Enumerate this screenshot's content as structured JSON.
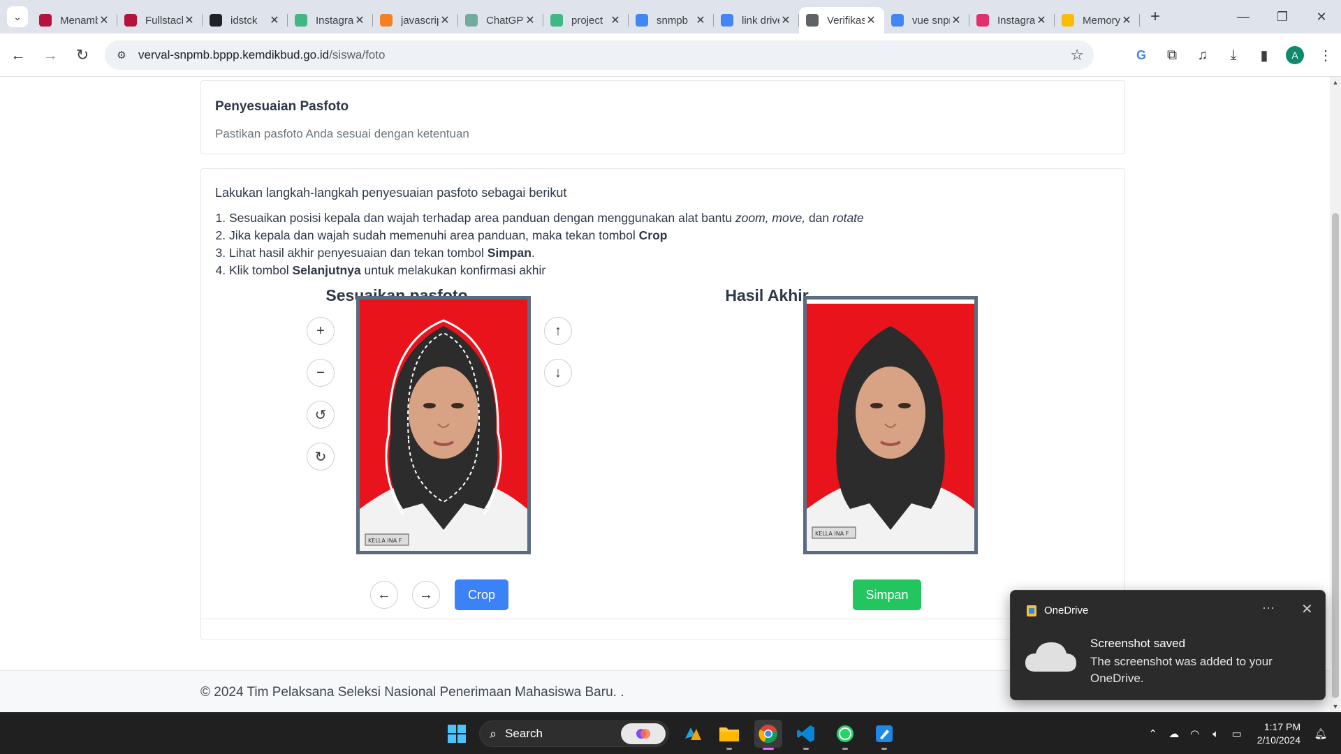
{
  "browser": {
    "tabs": [
      {
        "title": "Menambahkan",
        "favicon_color": "#b5123e",
        "active": false
      },
      {
        "title": "Fullstack",
        "favicon_color": "#b5123e",
        "active": false
      },
      {
        "title": "idstck",
        "favicon_color": "#1f2328",
        "active": false
      },
      {
        "title": "Instagram",
        "favicon_color": "#41b883",
        "active": false
      },
      {
        "title": "javascript",
        "favicon_color": "#f48024",
        "active": false
      },
      {
        "title": "ChatGPT",
        "favicon_color": "#74aa9c",
        "active": false
      },
      {
        "title": "project",
        "favicon_color": "#41b883",
        "active": false
      },
      {
        "title": "snmpb",
        "favicon_color": "#4285f4",
        "active": false
      },
      {
        "title": "link drive",
        "favicon_color": "#4285f4",
        "active": false
      },
      {
        "title": "Verifikasi",
        "favicon_color": "#5f6368",
        "active": true
      },
      {
        "title": "vue snpmb",
        "favicon_color": "#4285f4",
        "active": false
      },
      {
        "title": "Instagram",
        "favicon_color": "#e1306c",
        "active": false
      },
      {
        "title": "Memory",
        "favicon_color": "#fbbc05",
        "active": false
      }
    ],
    "url_host": "verval-snpmb.bppp.kemdikbud.go.id",
    "url_path": "/siswa/foto",
    "profile_initial": "A"
  },
  "header_card": {
    "title": "Penyesuaian Pasfoto",
    "subtitle": "Pastikan pasfoto Anda sesuai dengan ketentuan"
  },
  "instructions": {
    "intro": "Lakukan langkah-langkah penyesuaian pasfoto sebagai berikut",
    "step1_text": "Sesuaikan posisi kepala dan wajah terhadap area panduan dengan menggunakan alat bantu ",
    "step1_zoom": "zoom",
    "step1_move": "move",
    "step1_and": "dan",
    "step1_rotate": "rotate",
    "step2_text": "Jika kepala dan wajah sudah memenuhi area panduan, maka tekan tombol ",
    "step2_bold": "Crop",
    "step3_text": "Lihat hasil akhir penyesuaian dan tekan tombol ",
    "step3_bold": "Simpan",
    "step4_text": "Klik tombol ",
    "step4_bold": "Selanjutnya",
    "step4_rest": " untuk melakukan konfirmasi akhir"
  },
  "editor": {
    "title": "Sesuaikan pasfoto Anda",
    "crop_label": "Crop",
    "photo_id_label": "KELLA INA F",
    "background_color": "#e8131b"
  },
  "result": {
    "title": "Hasil Akhir",
    "save_label": "Simpan"
  },
  "footer": {
    "text": "© 2024 Tim Pelaksana Seleksi Nasional Penerimaan Mahasiswa Baru.   ."
  },
  "toast": {
    "app": "OneDrive",
    "title": "Screenshot saved",
    "body": "The screenshot was added to your OneDrive."
  },
  "taskbar": {
    "search_label": "Search",
    "time": "1:17 PM",
    "date": "2/10/2024"
  },
  "colors": {
    "crop_button": "#3b82f6",
    "save_button": "#22c55e",
    "frame_border": "#5b6b80"
  }
}
